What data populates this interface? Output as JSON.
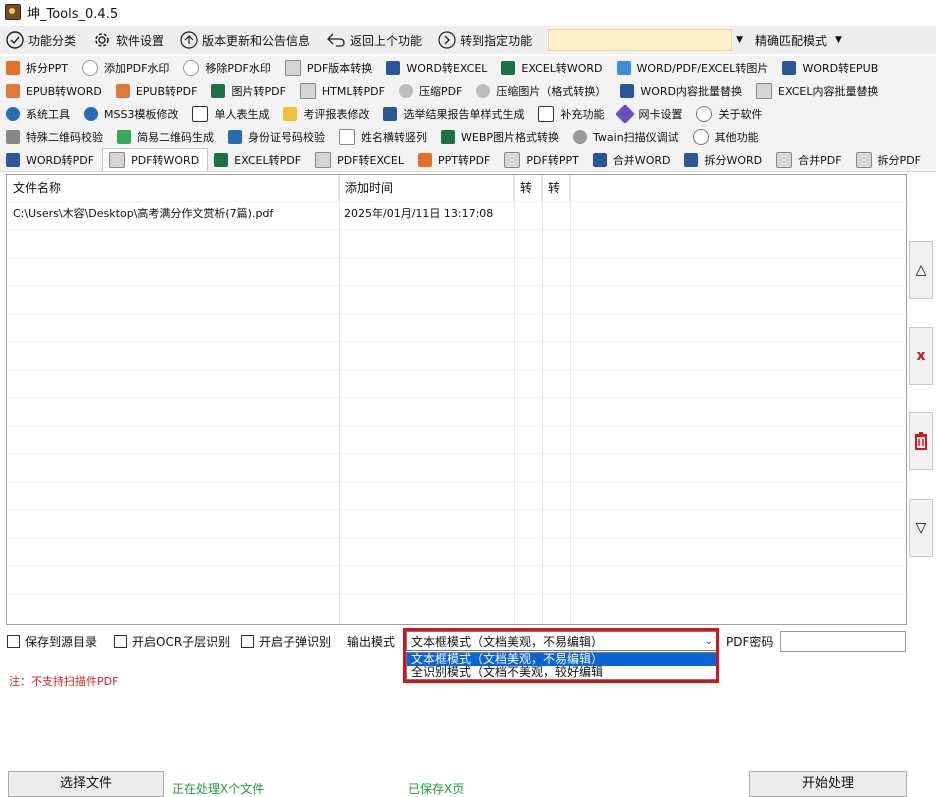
{
  "window": {
    "title": "坤_Tools_0.4.5"
  },
  "menubar": {
    "items": [
      {
        "label": "功能分类",
        "icon": "shield-check-icon"
      },
      {
        "label": "软件设置",
        "icon": "gear-icon"
      },
      {
        "label": "版本更新和公告信息",
        "icon": "upload-circle-icon"
      },
      {
        "label": "返回上个功能",
        "icon": "return-arrow-icon"
      },
      {
        "label": "转到指定功能",
        "icon": "next-circle-icon"
      }
    ],
    "search_value": "",
    "match_mode": "精确匹配模式"
  },
  "tab_rows": [
    [
      "拆分PPT",
      "添加PDF水印",
      "移除PDF水印",
      "PDF版本转换",
      "WORD转EXCEL",
      "EXCEL转WORD",
      "WORD/PDF/EXCEL转图片",
      "WORD转EPUB"
    ],
    [
      "EPUB转WORD",
      "EPUB转PDF",
      "图片转PDF",
      "HTML转PDF",
      "压缩PDF",
      "压缩图片（格式转换）",
      "WORD内容批量替换",
      "EXCEL内容批量替换"
    ],
    [
      "系统工具",
      "MSS3模板修改",
      "单人表生成",
      "考评报表修改",
      "选举结果报告单样式生成",
      "补充功能",
      "网卡设置",
      "关于软件"
    ],
    [
      "特殊二维码校验",
      "简易二维码生成",
      "身份证号码校验",
      "姓名横转竖列",
      "WEBP图片格式转换",
      "Twain扫描仪调试",
      "其他功能"
    ],
    [
      "WORD转PDF",
      "PDF转WORD",
      "EXCEL转PDF",
      "PDF转EXCEL",
      "PPT转PDF",
      "PDF转PPT",
      "合并WORD",
      "拆分WORD",
      "合并PDF",
      "拆分PDF"
    ]
  ],
  "active_tab": "PDF转WORD",
  "file_list": {
    "columns": [
      "文件名称",
      "添加时间",
      "转",
      "转"
    ],
    "rows": [
      {
        "name": "C:\\Users\\木容\\Desktop\\高考满分作文赏析(7篇).pdf",
        "time": "2025年/01月/11日 13:17:08"
      }
    ]
  },
  "side_buttons": {
    "up": "△",
    "delete": "x",
    "down": "▽"
  },
  "options": {
    "save_to_source": "保存到源目录",
    "ocr_layer": "开启OCR子层识别",
    "popup_recognize": "开启子弹识别",
    "output_mode_label": "输出模式",
    "output_mode_value": "文本框模式（文档美观，不易编辑）",
    "output_mode_options": [
      "文本框模式（文档美观，不易编辑）",
      "全识别模式（文档不美观，较好编辑"
    ],
    "pdf_password_label": "PDF密码",
    "pdf_password_value": ""
  },
  "note": "注：不支持扫描件PDF",
  "bottom": {
    "select_file": "选择文件",
    "status_left": "正在处理X个文件",
    "status_mid": "已保存X页",
    "start": "开始处理"
  },
  "colors": {
    "highlight": "#d0161b",
    "selection": "#0a64d8",
    "note": "#d32020",
    "status": "#1b9e3a"
  }
}
